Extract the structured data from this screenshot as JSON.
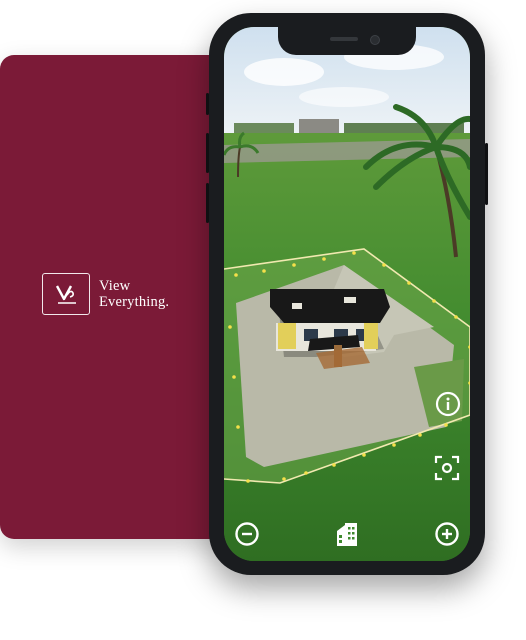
{
  "brand": {
    "logo_line1": "View",
    "logo_line2": "Everything.",
    "background_color": "#7b1a37"
  },
  "ar_view": {
    "controls": {
      "info": {
        "icon": "info-icon"
      },
      "recenter": {
        "icon": "focus-scan-icon"
      },
      "zoom_out": {
        "icon": "minus-circle-icon"
      },
      "building": {
        "icon": "building-icon"
      },
      "zoom_in": {
        "icon": "plus-circle-icon"
      }
    }
  }
}
